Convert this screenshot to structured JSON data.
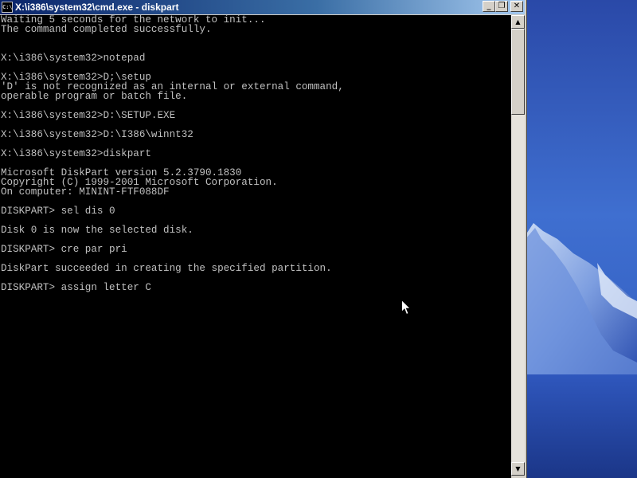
{
  "window": {
    "title": "X:\\i386\\system32\\cmd.exe - diskpart",
    "icon_text": "C:\\",
    "buttons": {
      "minimize": "_",
      "maximize": "❐",
      "close": "✕"
    }
  },
  "console": {
    "text_color": "#c0c0c0",
    "background": "#000000",
    "lines": [
      "Waiting 5 seconds for the network to init...",
      "The command completed successfully.",
      "",
      "",
      "X:\\i386\\system32>notepad",
      "",
      "X:\\i386\\system32>D;\\setup",
      "'D' is not recognized as an internal or external command,",
      "operable program or batch file.",
      "",
      "X:\\i386\\system32>D:\\SETUP.EXE",
      "",
      "X:\\i386\\system32>D:\\I386\\winnt32",
      "",
      "X:\\i386\\system32>diskpart",
      "",
      "Microsoft DiskPart version 5.2.3790.1830",
      "Copyright (C) 1999-2001 Microsoft Corporation.",
      "On computer: MININT-FTF088DF",
      "",
      "DISKPART> sel dis 0",
      "",
      "Disk 0 is now the selected disk.",
      "",
      "DISKPART> cre par pri",
      "",
      "DiskPart succeeded in creating the specified partition.",
      "",
      "DISKPART> assign letter C"
    ]
  },
  "scrollbar": {
    "up_arrow": "▲",
    "down_arrow": "▼"
  },
  "colors": {
    "titlebar_start": "#0a246a",
    "titlebar_end": "#a6caf0",
    "window_chrome": "#d4d0c8",
    "desktop": "#2c52b8"
  }
}
